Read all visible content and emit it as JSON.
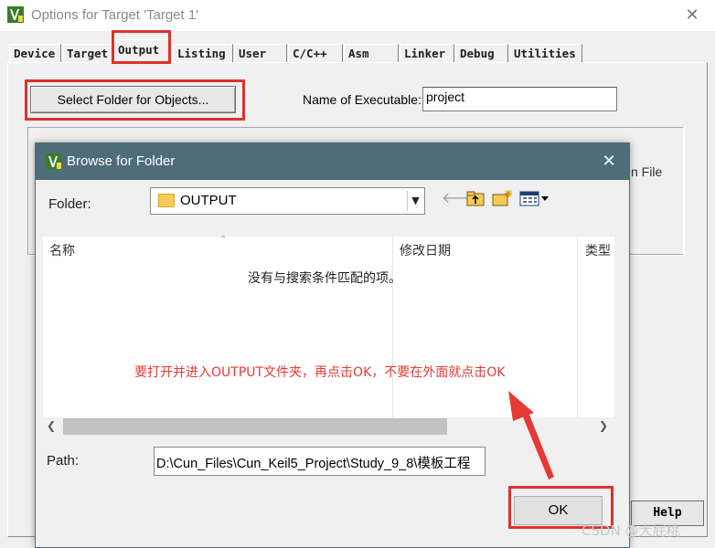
{
  "outer_window": {
    "title": "Options for Target 'Target 1'",
    "close_glyph": "✕",
    "app_icon": "keil-uvision-icon"
  },
  "tabs": [
    {
      "label": "Device",
      "active": false
    },
    {
      "label": "Target",
      "active": false
    },
    {
      "label": "Output",
      "active": true
    },
    {
      "label": "Listing",
      "active": false
    },
    {
      "label": "User",
      "active": false
    },
    {
      "label": "C/C++",
      "active": false
    },
    {
      "label": "Asm",
      "active": false
    },
    {
      "label": "Linker",
      "active": false
    },
    {
      "label": "Debug",
      "active": false
    },
    {
      "label": "Utilities",
      "active": false
    }
  ],
  "output_tab": {
    "select_folder_label": "Select Folder for Objects...",
    "exe_label": "Name of Executable:",
    "exe_value": "project",
    "group_tail_text": "n File"
  },
  "help_label": "Help",
  "dialog": {
    "title": "Browse for Folder",
    "close_glyph": "✕",
    "folder_label": "Folder:",
    "folder_value": "OUTPUT",
    "toolbar_icons": [
      "back-arrow-icon",
      "up-folder-icon",
      "new-folder-icon",
      "view-menu-icon"
    ],
    "columns": [
      "名称",
      "修改日期",
      "类型"
    ],
    "empty_message": "没有与搜索条件匹配的项。",
    "path_label": "Path:",
    "path_value": "D:\\Cun_Files\\Cun_Keil5_Project\\Study_9_8\\模板工程",
    "ok_label": "OK"
  },
  "annotation_text": "要打开并进入OUTPUT文件夹，再点击OK，不要在外面就点击OK",
  "watermark": "CSDN @大屁桃",
  "colors": {
    "highlight": "#e0302e",
    "annotation": "#e53935",
    "dialog_titlebar": "#4e6d7b",
    "folder_icon": "#f4cc55"
  }
}
